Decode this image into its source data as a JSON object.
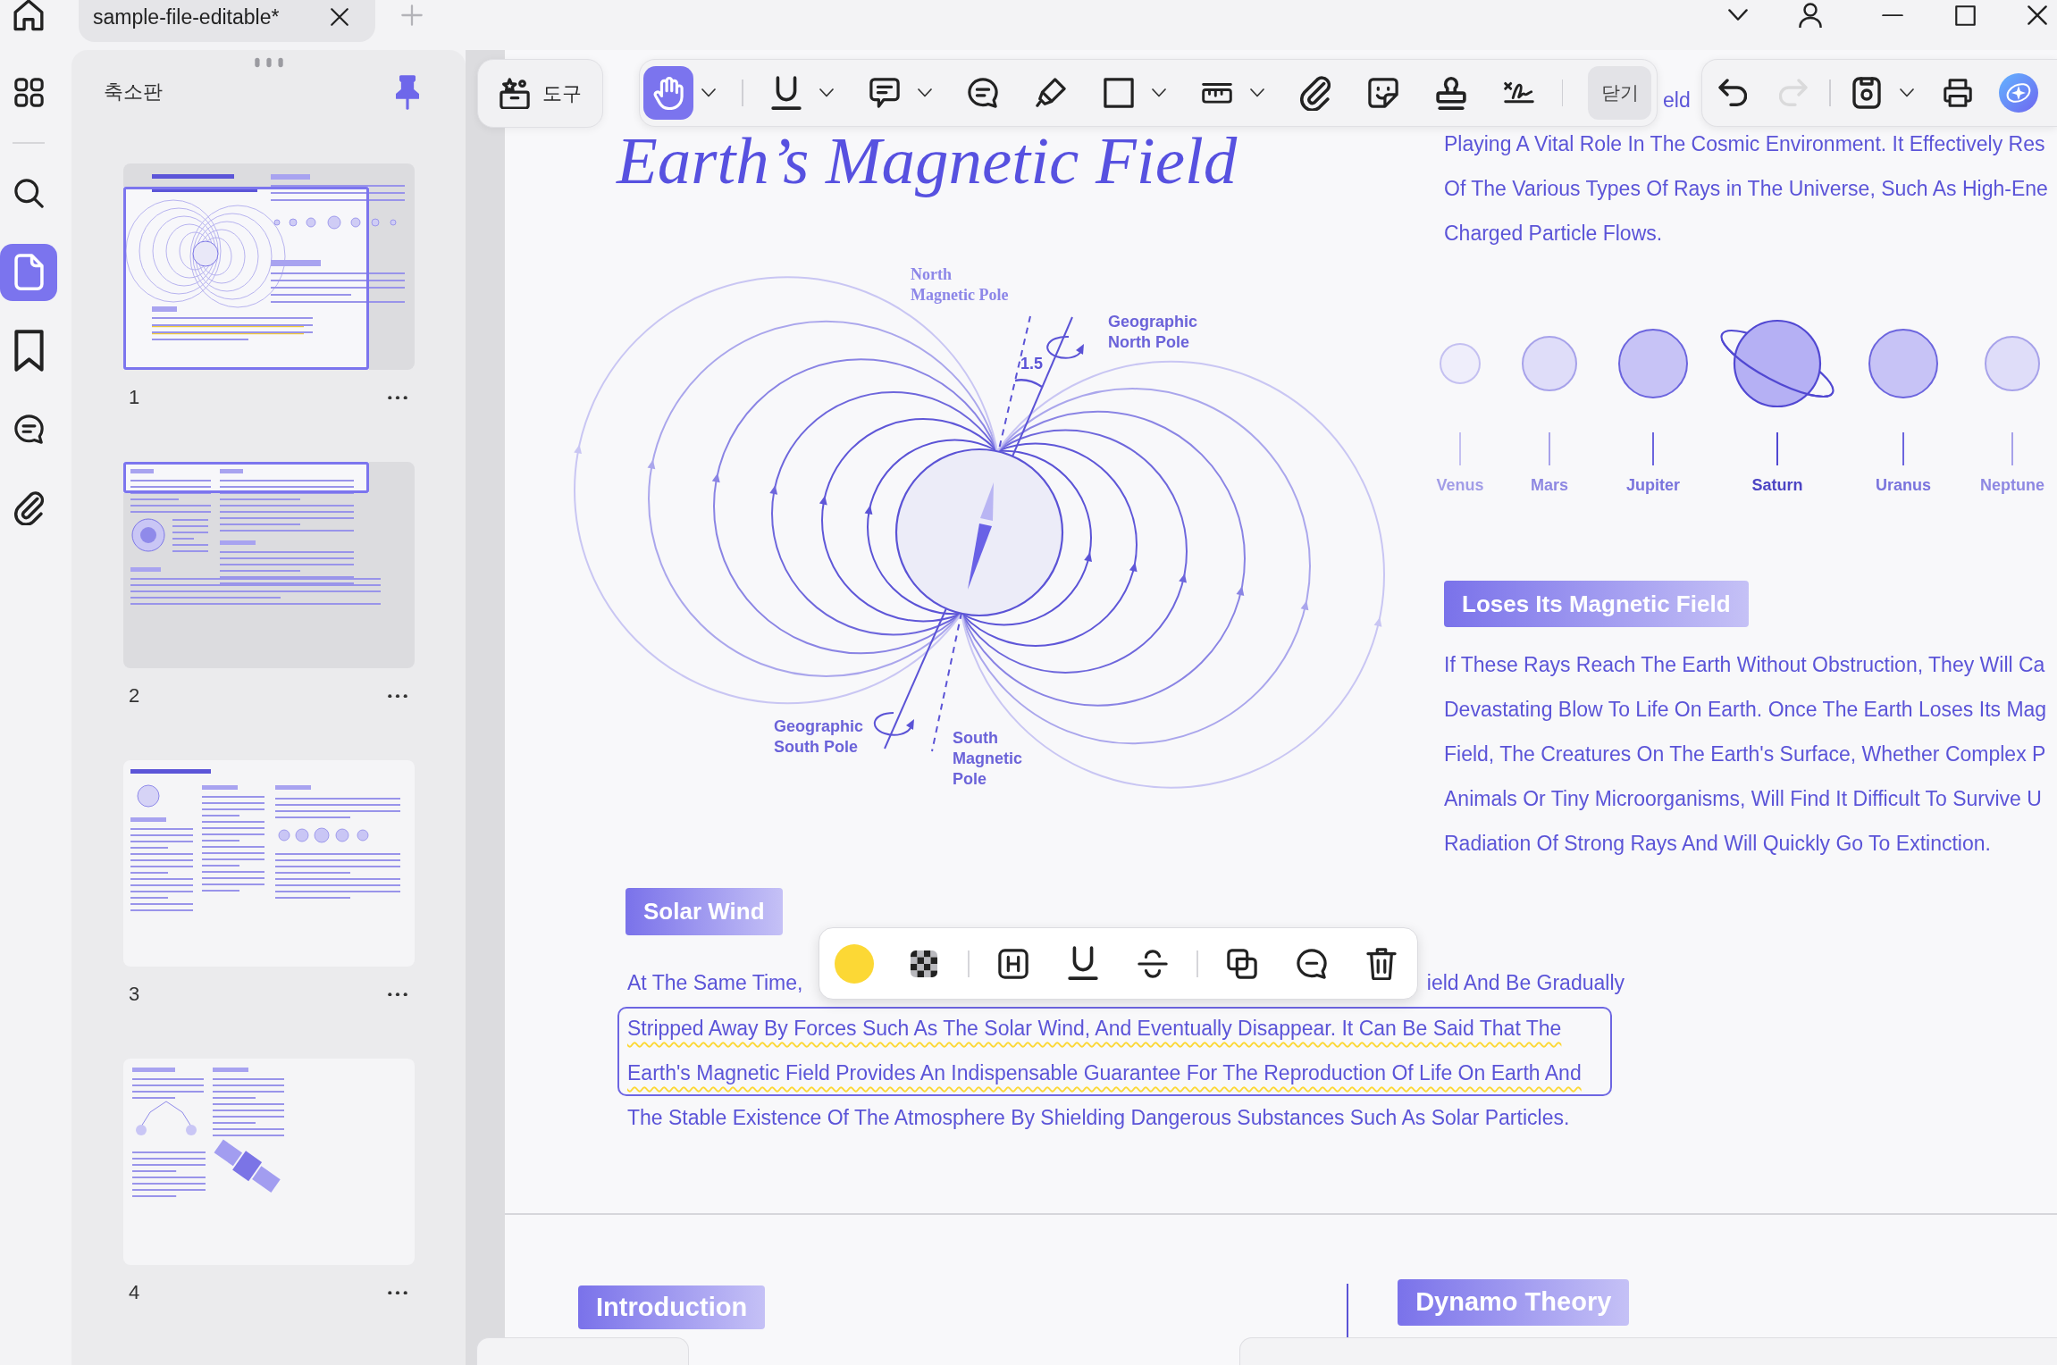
{
  "window": {
    "tab": {
      "title": "sample-file-editable*"
    }
  },
  "rail": {
    "groups": [
      {
        "items": [
          {
            "kind": "grid",
            "selected": false
          }
        ]
      },
      {
        "items": [
          {
            "kind": "search",
            "selected": false
          },
          {
            "kind": "pages",
            "selected": true
          },
          {
            "kind": "bookmarks",
            "selected": false
          },
          {
            "kind": "comments",
            "selected": false
          },
          {
            "kind": "attachments",
            "selected": false
          }
        ]
      }
    ]
  },
  "sidebar": {
    "title": "축소판",
    "pinned": true,
    "pages": [
      {
        "number": "1",
        "kind": "magnetic-field",
        "in_view": true
      },
      {
        "number": "2",
        "kind": "layers",
        "in_view": true
      },
      {
        "number": "3",
        "kind": "evidence",
        "in_view": false
      },
      {
        "number": "4",
        "kind": "satellite",
        "in_view": false
      }
    ]
  },
  "toolbar": {
    "label": "도구",
    "groups": [
      {
        "tools": [
          {
            "kind": "hand",
            "selected": true,
            "menu": true
          }
        ]
      },
      {
        "tools": [
          {
            "kind": "underline",
            "selected": false,
            "menu": true
          },
          {
            "kind": "note",
            "selected": false,
            "menu": true
          },
          {
            "kind": "comment",
            "selected": false,
            "menu": false
          },
          {
            "kind": "highlighter",
            "selected": false,
            "menu": false
          },
          {
            "kind": "rectangle",
            "selected": false,
            "menu": true
          },
          {
            "kind": "measure",
            "selected": false,
            "menu": true
          },
          {
            "kind": "attachment",
            "selected": false,
            "menu": false
          },
          {
            "kind": "sticker",
            "selected": false,
            "menu": false
          },
          {
            "kind": "stamp",
            "selected": false,
            "menu": false
          },
          {
            "kind": "signature",
            "selected": false,
            "menu": false
          }
        ]
      }
    ],
    "close_label": "닫기"
  },
  "actions": {
    "groups": [
      {
        "items": [
          {
            "kind": "undo",
            "disabled": false,
            "menu": false
          },
          {
            "kind": "redo",
            "disabled": true,
            "menu": false
          }
        ]
      },
      {
        "items": [
          {
            "kind": "save",
            "disabled": false,
            "menu": true
          },
          {
            "kind": "print",
            "disabled": false,
            "menu": false
          },
          {
            "kind": "assistant",
            "disabled": false,
            "menu": false
          }
        ]
      }
    ]
  },
  "document": {
    "title": "Earth’s Magnetic Field",
    "fragment": "eld",
    "intro": {
      "lines": [
        "Playing A Vital Role In The Cosmic Environment. It Effectively Res",
        "Of The Various Types Of Rays in The Universe, Such As High-Ene",
        "Charged Particle Flows."
      ]
    },
    "diagram": {
      "labels": [
        {
          "kind": "north-magnetic",
          "lines": [
            "North",
            "Magnetic Pole"
          ]
        },
        {
          "kind": "geographic-north",
          "lines": [
            "Geographic",
            "North Pole"
          ]
        },
        {
          "kind": "angle",
          "lines": [
            "1.5"
          ]
        },
        {
          "kind": "geographic-south",
          "lines": [
            "Geographic",
            "South Pole"
          ]
        },
        {
          "kind": "south-magnetic",
          "lines": [
            "South",
            "Magnetic",
            "Pole"
          ]
        }
      ]
    },
    "planets": [
      {
        "name": "Venus",
        "kind": "small"
      },
      {
        "name": "Mars",
        "kind": "medium"
      },
      {
        "name": "Jupiter",
        "kind": "large"
      },
      {
        "name": "Saturn",
        "kind": "ringed"
      },
      {
        "name": "Uranus",
        "kind": "large"
      },
      {
        "name": "Neptune",
        "kind": "medium"
      }
    ],
    "magnetic_loss": {
      "heading": "Loses Its Magnetic Field",
      "lines": [
        "If These Rays Reach The Earth Without Obstruction, They Will Ca",
        "Devastating Blow To Life On Earth. Once The Earth Loses Its Mag",
        "Field, The Creatures On The Earth's Surface, Whether Complex P",
        "Animals Or Tiny Microorganisms, Will Find It Difficult To Survive U",
        "Radiation Of Strong Rays And Will Quickly Go To Extinction."
      ]
    },
    "solar_wind": {
      "heading": "Solar Wind",
      "lines": [
        {
          "parts": [
            "At The Same Time,",
            "ield And Be Gradually"
          ],
          "highlighted": false
        },
        {
          "parts": [
            "Stripped Away By Forces Such As The Solar Wind, And Eventually Disappear. It Can Be Said That The"
          ],
          "highlighted": true
        },
        {
          "parts": [
            "Earth's Magnetic Field Provides An Indispensable Guarantee For The Reproduction Of Life On Earth And"
          ],
          "highlighted": true
        },
        {
          "parts": [
            "The Stable Existence Of The Atmosphere By Shielding Dangerous Substances Such As Solar Particles."
          ],
          "highlighted": false
        }
      ]
    },
    "lower_headings": [
      "Introduction",
      "Dynamo Theory"
    ]
  },
  "annotation_toolbar": {
    "color": "#fcd835",
    "groups": [
      {
        "tools": [
          {
            "kind": "color"
          },
          {
            "kind": "opacity"
          }
        ]
      },
      {
        "tools": [
          {
            "kind": "text-box"
          },
          {
            "kind": "underline"
          },
          {
            "kind": "strikethrough"
          }
        ]
      },
      {
        "tools": [
          {
            "kind": "copy"
          },
          {
            "kind": "comment"
          },
          {
            "kind": "delete"
          }
        ]
      }
    ]
  }
}
